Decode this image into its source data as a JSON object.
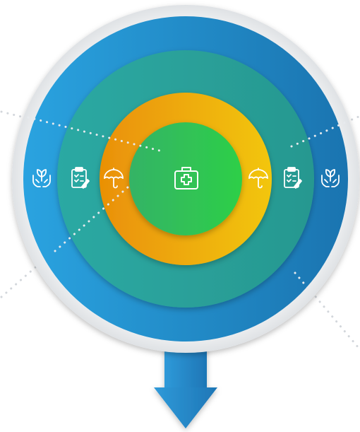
{
  "colors": {
    "background": "#ffffff",
    "outer_rim": "#e6e8ea",
    "outer_ring_left": "#2a9fdc",
    "outer_ring_right": "#1e7bb8",
    "teal_ring_left": "#2fa7a0",
    "teal_ring_right": "#2a9a93",
    "yellow_ring_left": "#ec9b07",
    "yellow_ring_right": "#f1c40f",
    "center_left": "#32b860",
    "center_right": "#2fcc4f",
    "arrow": "#2a8ed0",
    "arrow_dark": "#1e6fa8",
    "icon_stroke": "#ffffff",
    "dots": "#cfd3d8"
  },
  "icons": {
    "center": "first-aid-kit-icon",
    "yellow_ring": "umbrella-icon",
    "teal_ring": "clipboard-checklist-icon",
    "outer_ring": "hands-plant-icon"
  }
}
